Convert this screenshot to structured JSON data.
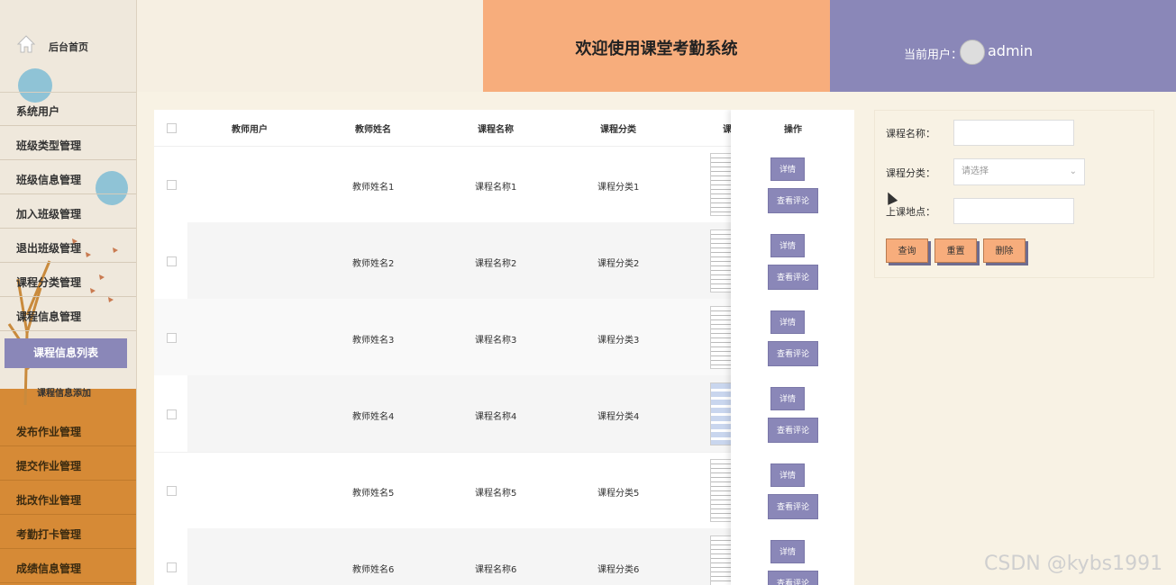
{
  "sidebar": {
    "home_label": "后台首页",
    "items": [
      {
        "label": "系统用户"
      },
      {
        "label": "班级类型管理"
      },
      {
        "label": "班级信息管理"
      },
      {
        "label": "加入班级管理"
      },
      {
        "label": "退出班级管理"
      },
      {
        "label": "课程分类管理"
      },
      {
        "label": "课程信息管理"
      }
    ],
    "submenu_active": "课程信息列表",
    "submenu_item": "课程信息添加",
    "items_bottom": [
      {
        "label": "发布作业管理"
      },
      {
        "label": "提交作业管理"
      },
      {
        "label": "批改作业管理"
      },
      {
        "label": "考勤打卡管理"
      },
      {
        "label": "成绩信息管理"
      }
    ]
  },
  "header": {
    "title": "欢迎使用课堂考勤系统",
    "user_label": "当前用户：",
    "username": "admin"
  },
  "table": {
    "columns": [
      "教师用户",
      "教师姓名",
      "课程名称",
      "课程分类",
      "课",
      "操作"
    ],
    "rows": [
      {
        "teacher_name": "教师姓名1",
        "course_name": "课程名称1",
        "category": "课程分类1"
      },
      {
        "teacher_name": "教师姓名2",
        "course_name": "课程名称2",
        "category": "课程分类2"
      },
      {
        "teacher_name": "教师姓名3",
        "course_name": "课程名称3",
        "category": "课程分类3"
      },
      {
        "teacher_name": "教师姓名4",
        "course_name": "课程名称4",
        "category": "课程分类4"
      },
      {
        "teacher_name": "教师姓名5",
        "course_name": "课程名称5",
        "category": "课程分类5"
      },
      {
        "teacher_name": "教师姓名6",
        "course_name": "课程名称6",
        "category": "课程分类6"
      }
    ],
    "detail_label": "详情",
    "review_label": "查看评论"
  },
  "search": {
    "course_name_label": "课程名称：",
    "category_label": "课程分类：",
    "category_placeholder": "请选择",
    "location_label": "上课地点：",
    "query_button": "查询",
    "reset_button": "重置",
    "delete_button": "删除"
  },
  "watermark": "CSDN @kybs1991",
  "colors": {
    "accent_purple": "#8a87b8",
    "accent_orange": "#f7ad7c",
    "sidebar_orange": "#d68a36"
  }
}
